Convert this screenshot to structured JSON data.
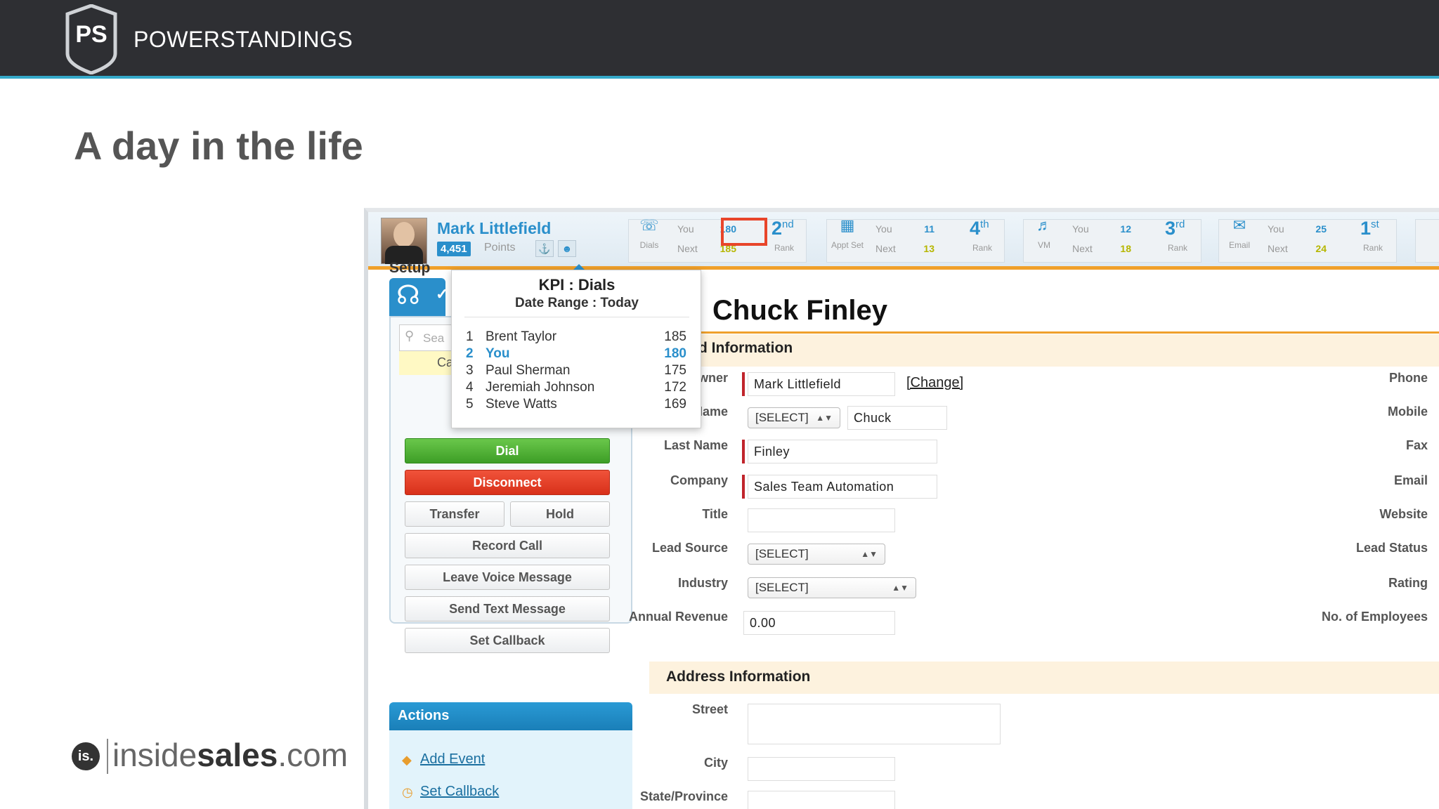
{
  "brand": {
    "shield_text": "PS",
    "name": "POWERSTANDINGS"
  },
  "slide": {
    "title": "A day in the life"
  },
  "footer_logo": {
    "mark": "is.",
    "word_light": "inside",
    "word_bold": "sales",
    "word_end": ".com"
  },
  "user": {
    "name": "Mark Littlefield",
    "points": "4,451",
    "points_label": "Points"
  },
  "kpis": [
    {
      "label": "Dials",
      "you": "You",
      "next": "Next",
      "you_val": "180",
      "next_val": "185",
      "rank_num": "2",
      "rank_suffix": "nd",
      "rank_label": "Rank"
    },
    {
      "label": "Appt Set",
      "you": "You",
      "next": "Next",
      "you_val": "11",
      "next_val": "13",
      "rank_num": "4",
      "rank_suffix": "th",
      "rank_label": "Rank"
    },
    {
      "label": "VM",
      "you": "You",
      "next": "Next",
      "you_val": "12",
      "next_val": "18",
      "rank_num": "3",
      "rank_suffix": "rd",
      "rank_label": "Rank"
    },
    {
      "label": "Email",
      "you": "You",
      "next": "Next",
      "you_val": "25",
      "next_val": "24",
      "rank_num": "1",
      "rank_suffix": "st",
      "rank_label": "Rank"
    }
  ],
  "popup": {
    "title": "KPI : Dials",
    "subtitle": "Date Range : Today",
    "rows": [
      {
        "rank": "1",
        "name": "Brent Taylor",
        "value": "185"
      },
      {
        "rank": "2",
        "name": "You",
        "value": "180"
      },
      {
        "rank": "3",
        "name": "Paul Sherman",
        "value": "175"
      },
      {
        "rank": "4",
        "name": "Jeremiah Johnson",
        "value": "172"
      },
      {
        "rank": "5",
        "name": "Steve Watts",
        "value": "169"
      }
    ]
  },
  "phone": {
    "setup_label": "Setup",
    "search_placeholder": "Sea",
    "call_tab": "Ca",
    "dial": "Dial",
    "disconnect": "Disconnect",
    "transfer": "Transfer",
    "hold": "Hold",
    "record": "Record Call",
    "voice": "Leave Voice Message",
    "text": "Send Text Message",
    "callback": "Set Callback"
  },
  "actions": {
    "title": "Actions",
    "add_event": "Add Event",
    "set_callback": "Set Callback"
  },
  "lead": {
    "name": "Chuck Finley",
    "section_title": "d Information",
    "fields": {
      "lead_owner_label": "Lead Owner",
      "lead_owner": "Mark Littlefield",
      "change": "[Change]",
      "first_name_label": "First Name",
      "salutation": "[SELECT]",
      "first_name": "Chuck",
      "last_name_label": "Last Name",
      "last_name": "Finley",
      "company_label": "Company",
      "company": "Sales Team Automation",
      "title_label": "Title",
      "lead_source_label": "Lead Source",
      "lead_source": "[SELECT]",
      "industry_label": "Industry",
      "industry": "[SELECT]",
      "annual_revenue_label": "Annual Revenue",
      "annual_revenue": "0.00"
    },
    "right_labels": [
      "Phone",
      "Mobile",
      "Fax",
      "Email",
      "Website",
      "Lead Status",
      "Rating",
      "No. of Employees"
    ],
    "address_title": "Address Information",
    "address_labels": {
      "street": "Street",
      "city": "City",
      "state": "State/Province"
    }
  }
}
